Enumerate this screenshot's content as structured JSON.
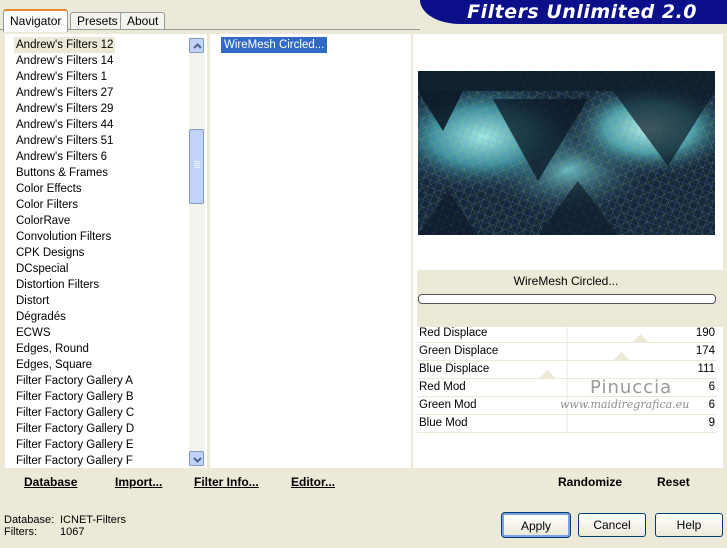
{
  "tabs": [
    {
      "label": "Navigator",
      "active": true
    },
    {
      "label": "Presets",
      "active": false
    },
    {
      "label": "About",
      "active": false
    }
  ],
  "banner": {
    "title": "Filters Unlimited 2.0"
  },
  "categories": {
    "selected": "Andrew's Filters 12",
    "items": [
      "Andrew's Filters 12",
      "Andrew's Filters 14",
      "Andrew's Filters 1",
      "Andrew's Filters 27",
      "Andrew's Filters 29",
      "Andrew's Filters 44",
      "Andrew's Filters 51",
      "Andrew's Filters 6",
      "Buttons & Frames",
      "Color Effects",
      "Color Filters",
      "ColorRave",
      "Convolution Filters",
      "CPK Designs",
      "DCspecial",
      "Distortion Filters",
      "Distort",
      "Dégradés",
      "ECWS",
      "Edges, Round",
      "Edges, Square",
      "Filter Factory Gallery A",
      "Filter Factory Gallery B",
      "Filter Factory Gallery C",
      "Filter Factory Gallery D",
      "Filter Factory Gallery E",
      "Filter Factory Gallery F"
    ]
  },
  "filters": {
    "items": [
      "WireMesh Circled..."
    ],
    "selected": "WireMesh Circled..."
  },
  "preview": {
    "filter_name": "WireMesh Circled..."
  },
  "parameters": [
    {
      "label": "Red Displace",
      "value": "190",
      "level": 0.745
    },
    {
      "label": "Green Displace",
      "value": "174",
      "level": 0.682
    },
    {
      "label": "Blue Displace",
      "value": "111",
      "level": 0.435
    },
    {
      "label": "Red Mod",
      "value": "6",
      "level": null
    },
    {
      "label": "Green Mod",
      "value": "6",
      "level": null
    },
    {
      "label": "Blue Mod",
      "value": "9",
      "level": null
    }
  ],
  "watermark": {
    "name": "Pinuccia",
    "site": "www.maidiregrafica.eu"
  },
  "left_buttons": {
    "database": "Database",
    "import": "Import...",
    "filter_info": "Filter Info...",
    "editor": "Editor..."
  },
  "right_buttons": {
    "randomize": "Randomize",
    "reset": "Reset"
  },
  "status": {
    "database_label": "Database:",
    "database_value": "ICNET-Filters",
    "filters_label": "Filters:",
    "filters_value": "1067"
  },
  "dialog": {
    "apply": "Apply",
    "cancel": "Cancel",
    "help": "Help"
  },
  "colors": {
    "selection": "#316ac5",
    "banner": "#0c0f8a",
    "face": "#ece9d8"
  }
}
